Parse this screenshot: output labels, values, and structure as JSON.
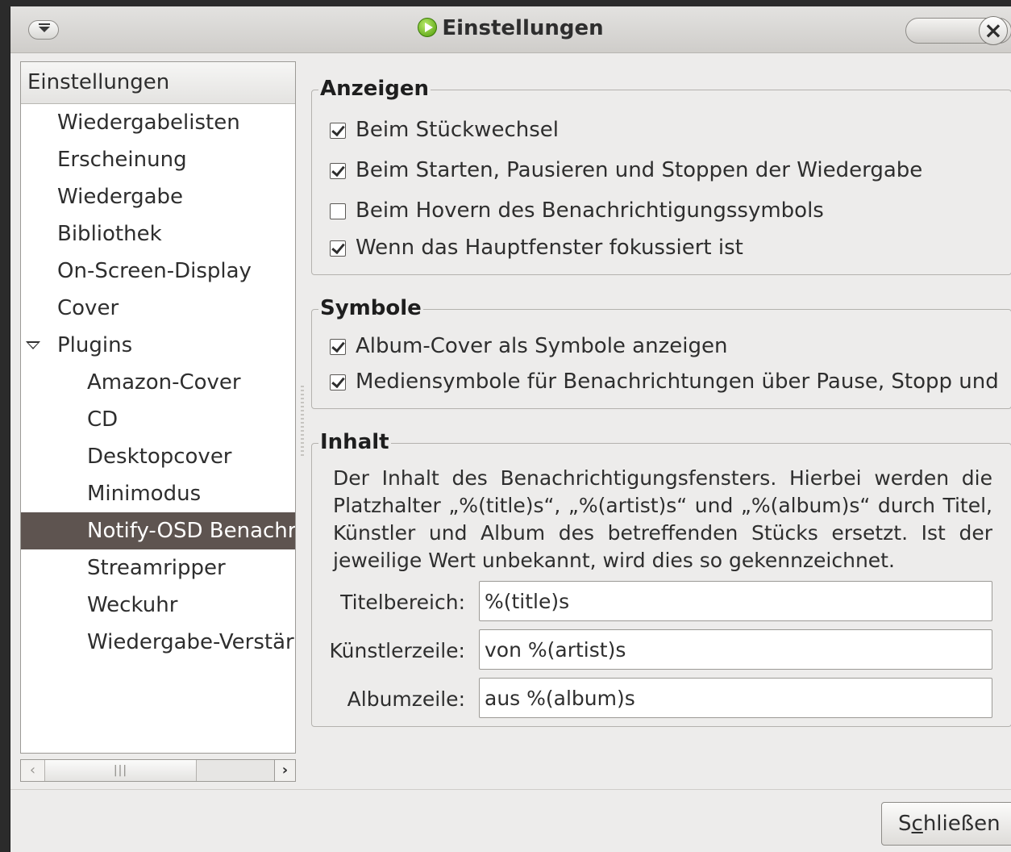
{
  "window": {
    "title": "Einstellungen"
  },
  "tree": {
    "header": "Einstellungen",
    "items": [
      {
        "label": "Wiedergabelisten"
      },
      {
        "label": "Erscheinung"
      },
      {
        "label": "Wiedergabe"
      },
      {
        "label": "Bibliothek"
      },
      {
        "label": "On-Screen-Display"
      },
      {
        "label": "Cover"
      },
      {
        "label": "Plugins"
      },
      {
        "label": "Amazon-Cover"
      },
      {
        "label": "CD"
      },
      {
        "label": "Desktopcover"
      },
      {
        "label": "Minimodus"
      },
      {
        "label": "Notify-OSD Benachr"
      },
      {
        "label": "Streamripper"
      },
      {
        "label": "Weckuhr"
      },
      {
        "label": "Wiedergabe-Verstär"
      }
    ],
    "selected": "Notify-OSD Benachr"
  },
  "anzeigen": {
    "title": "Anzeigen",
    "options": [
      {
        "label": "Beim Stückwechsel",
        "checked": true
      },
      {
        "label": "Beim Starten, Pausieren und Stoppen der Wiedergabe",
        "checked": true
      },
      {
        "label": "Beim Hovern des Benachrichtigungssymbols",
        "checked": false
      },
      {
        "label": "Wenn das Hauptfenster fokussiert ist",
        "checked": true
      }
    ]
  },
  "symbole": {
    "title": "Symbole",
    "options": [
      {
        "label": "Album-Cover als Symbole anzeigen",
        "checked": true
      },
      {
        "label": "Mediensymbole für Benachrichtungen über Pause, Stopp und",
        "checked": true
      }
    ]
  },
  "inhalt": {
    "title": "Inhalt",
    "description": "Der Inhalt des Benachrichtigungsfensters. Hierbei werden die Platzhalter „%(title)s“, „%(artist)s“ und „%(album)s“ durch Titel, Künstler und Album des betreffenden Stücks ersetzt. Ist der jeweilige Wert unbekannt, wird dies so gekennzeichnet.",
    "fields": [
      {
        "label": "Titelbereich:",
        "value": "%(title)s"
      },
      {
        "label": "Künstlerzeile:",
        "value": "von %(artist)s"
      },
      {
        "label": "Albumzeile:",
        "value": "aus %(album)s"
      }
    ]
  },
  "footer": {
    "close_prefix": "S",
    "close_mnemonic": "c",
    "close_rest": "hließen"
  }
}
